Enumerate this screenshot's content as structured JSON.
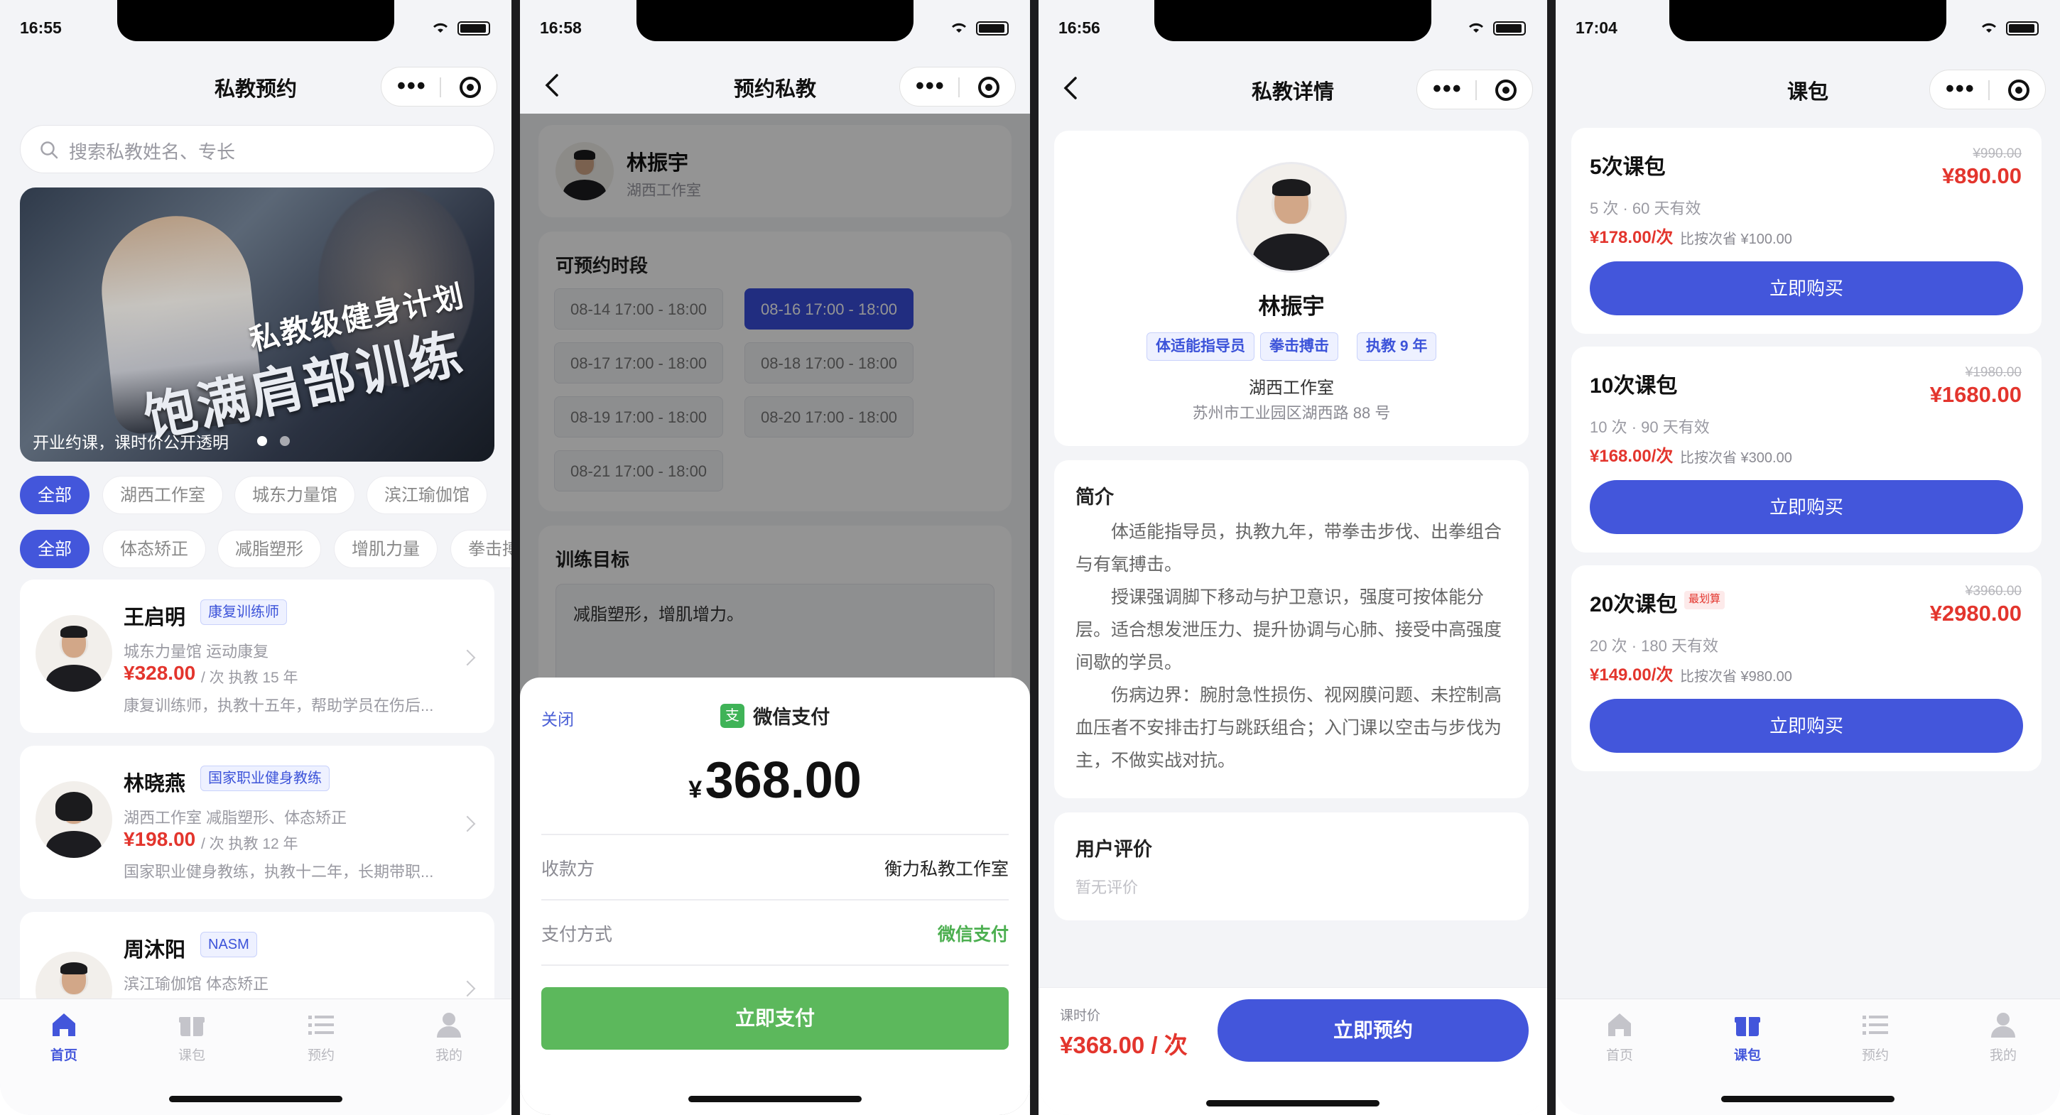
{
  "colors": {
    "accent": "#4356db",
    "price_red": "#e3352d",
    "pay_green": "#5cb85c"
  },
  "screens": {
    "home": {
      "status_time": "16:55",
      "title": "私教预约",
      "search_placeholder": "搜索私教姓名、专长",
      "banner": {
        "line1": "私教级健身计划",
        "line2": "饱满肩部训练",
        "caption": "开业约课，课时价公开透明"
      },
      "studio_chips": [
        "全部",
        "湖西工作室",
        "城东力量馆",
        "滨江瑜伽馆"
      ],
      "goal_chips": [
        "全部",
        "体态矫正",
        "减脂塑形",
        "增肌力量",
        "拳击搏"
      ],
      "coaches": [
        {
          "name": "王启明",
          "tag": "康复训练师",
          "meta": "城东力量馆  运动康复",
          "price": "¥328.00",
          "unit": "/ 次  执教 15 年",
          "desc": "康复训练师，执教十五年，帮助学员在伤后..."
        },
        {
          "name": "林晓燕",
          "tag": "国家职业健身教练",
          "meta": "湖西工作室  减脂塑形、体态矫正",
          "price": "¥198.00",
          "unit": "/ 次  执教 12 年",
          "desc": "国家职业健身教练，执教十二年，长期带职..."
        },
        {
          "name": "周沐阳",
          "tag": "NASM",
          "meta": "滨江瑜伽馆  体态矫正",
          "price": "",
          "unit": "",
          "desc": ""
        }
      ],
      "tabs": [
        "首页",
        "课包",
        "预约",
        "我的"
      ]
    },
    "booking": {
      "status_time": "16:58",
      "title": "预约私教",
      "coach_name": "林振宇",
      "coach_studio": "湖西工作室",
      "slots_title": "可预约时段",
      "slots": [
        "08-14 17:00 - 18:00",
        "08-16 17:00 - 18:00",
        "08-17 17:00 - 18:00",
        "08-18 17:00 - 18:00",
        "08-19 17:00 - 18:00",
        "08-20 17:00 - 18:00",
        "08-21 17:00 - 18:00"
      ],
      "selected_slot": "08-16 17:00 - 18:00",
      "goal_title": "训练目标",
      "goal_value": "减脂塑形，增肌增力。",
      "pay": {
        "close": "关闭",
        "icon_char": "支",
        "method_title": "微信支付",
        "currency": "¥",
        "amount": "368.00",
        "payee_label": "收款方",
        "payee": "衡力私教工作室",
        "method_label": "支付方式",
        "method_value": "微信支付",
        "pay_button": "立即支付"
      }
    },
    "detail": {
      "status_time": "16:56",
      "title": "私教详情",
      "coach_name": "林振宇",
      "tags": [
        "体适能指导员",
        "拳击搏击",
        "执教 9 年"
      ],
      "studio": "湖西工作室",
      "address": "苏州市工业园区湖西路 88 号",
      "intro_title": "简介",
      "intro_paragraphs": [
        "体适能指导员，执教九年，带拳击步伐、出拳组合与有氧搏击。",
        "授课强调脚下移动与护卫意识，强度可按体能分层。适合想发泄压力、提升协调与心肺、接受中高强度间歇的学员。",
        "伤病边界：腕肘急性损伤、视网膜问题、未控制高血压者不安排击打与跳跃组合；入门课以空击与步伐为主，不做实战对抗。"
      ],
      "review_title": "用户评价",
      "review_empty": "暂无评价",
      "price_label": "课时价",
      "price": "¥368.00 / 次",
      "book_button": "立即预约"
    },
    "packages": {
      "status_time": "17:04",
      "title": "课包",
      "items": [
        {
          "name": "5次课包",
          "badge": "",
          "orig": "¥990.00",
          "price": "¥890.00",
          "info": "5 次 · 60 天有效",
          "per": "¥178.00/次",
          "save": "比按次省 ¥100.00",
          "buy": "立即购买"
        },
        {
          "name": "10次课包",
          "badge": "",
          "orig": "¥1980.00",
          "price": "¥1680.00",
          "info": "10 次 · 90 天有效",
          "per": "¥168.00/次",
          "save": "比按次省 ¥300.00",
          "buy": "立即购买"
        },
        {
          "name": "20次课包",
          "badge": "最划算",
          "orig": "¥3960.00",
          "price": "¥2980.00",
          "info": "20 次 · 180 天有效",
          "per": "¥149.00/次",
          "save": "比按次省 ¥980.00",
          "buy": "立即购买"
        }
      ],
      "tabs": [
        "首页",
        "课包",
        "预约",
        "我的"
      ]
    }
  }
}
